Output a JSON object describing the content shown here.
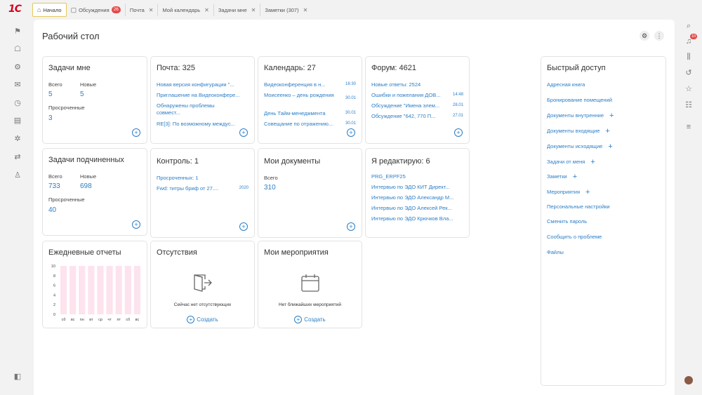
{
  "app": {
    "logo": "1C"
  },
  "tabs": [
    {
      "label": "Начало",
      "icon": "home-icon",
      "active": true
    },
    {
      "label": "Обсуждения",
      "icon": "chat-icon",
      "badge": "26"
    },
    {
      "label": "Почта"
    },
    {
      "label": "Мой календарь"
    },
    {
      "label": "Задачи мне"
    },
    {
      "label": "Заметки (307)"
    }
  ],
  "left_nav": [
    "flag-icon",
    "users-icon",
    "gear-icon",
    "mail-icon",
    "clock-icon",
    "building-icon",
    "settings-icon",
    "sync-icon",
    "person-icon",
    "panel-toggle-icon"
  ],
  "right_nav": {
    "notification_badge": "10",
    "icons": [
      "search-icon",
      "bell-icon",
      "equalizer-icon",
      "history-icon",
      "star-icon",
      "group-icon",
      "filter-icon",
      "avatar"
    ]
  },
  "page": {
    "title": "Рабочий стол",
    "settings_icon": "gear-icon",
    "more_icon": "more-icon"
  },
  "cards": {
    "my_tasks": {
      "title": "Задачи мне",
      "total_label": "Всего",
      "total": "5",
      "new_label": "Новые",
      "new": "5",
      "overdue_label": "Просроченные",
      "overdue": "3"
    },
    "subordinate_tasks": {
      "title": "Задачи подчиненных",
      "total_label": "Всего",
      "total": "733",
      "new_label": "Новые",
      "new": "698",
      "overdue_label": "Просроченные",
      "overdue": "40"
    },
    "mail": {
      "title": "Почта: 325",
      "items": [
        "Новая версия конфигурации \"...",
        "Приглашение на Видеоконфере...",
        "Обнаружены проблемы совмест...",
        "RE[3]: По возможному междус..."
      ]
    },
    "calendar": {
      "title": "Календарь: 27",
      "items": [
        {
          "text": "Видеоконференция в н...",
          "time": "16:30"
        },
        {
          "text": "Моисеенко – день рождения",
          "time": "30.01"
        },
        {
          "text": "День Тайм-менеджмента",
          "time": "30.01"
        },
        {
          "text": "Совещание по отражению...",
          "time": "30.01"
        }
      ]
    },
    "forum": {
      "title": "Форум: 4621",
      "items": [
        {
          "text": "Новые ответы: 2524",
          "time": ""
        },
        {
          "text": "Ошибки и пожелания ДОВ...",
          "time": "14:48"
        },
        {
          "text": "Обсуждение \"Имена элем...",
          "time": "28.01"
        },
        {
          "text": "Обсуждение \"642, 770 П...",
          "time": "27.01"
        }
      ]
    },
    "control": {
      "title": "Контроль: 1",
      "items": [
        {
          "text": "Просроченных: 1",
          "time": ""
        },
        {
          "text": "Fwd: титры бриф от 27....",
          "time": "2020"
        }
      ]
    },
    "my_documents": {
      "title": "Мои документы",
      "total_label": "Всего",
      "total": "310"
    },
    "editing": {
      "title": "Я редактирую: 6",
      "items": [
        "PRG_ERPF25",
        "Интервью по ЭДО  КИТ Директ...",
        "Интервью по ЭДО Александр М...",
        "Интервью по ЭДО Алексей Рек...",
        "Интервью по ЭДО Крючков Вла..."
      ]
    },
    "daily_reports": {
      "title": "Ежедневные отчеты"
    },
    "absences": {
      "title": "Отсутствия",
      "empty": "Сейчас нет отсутствующих",
      "create": "Создать",
      "icon": "exit-door-icon"
    },
    "events": {
      "title": "Мои мероприятия",
      "empty": "Нет ближайших мероприятий",
      "create": "Создать",
      "icon": "calendar-icon"
    }
  },
  "quick_access": {
    "title": "Быстрый доступ",
    "items": [
      {
        "label": "Адресная книга",
        "plus": false
      },
      {
        "label": "Бронирование помещений",
        "plus": false
      },
      {
        "label": "Документы внутренние",
        "plus": true
      },
      {
        "label": "Документы входящие",
        "plus": true
      },
      {
        "label": "Документы исходящие",
        "plus": true
      },
      {
        "label": "Задачи от меня",
        "plus": true
      },
      {
        "label": "Заметки",
        "plus": true
      },
      {
        "label": "Мероприятия",
        "plus": true
      },
      {
        "label": "Персональные настройки",
        "plus": false
      },
      {
        "label": "Сменить пароль",
        "plus": false
      },
      {
        "label": "Сообщить о проблеме",
        "plus": false
      },
      {
        "label": "Файлы",
        "plus": false
      }
    ]
  },
  "chart_data": {
    "type": "bar",
    "categories": [
      "сб",
      "вс",
      "пн",
      "вт",
      "ср",
      "чт",
      "пт",
      "сб",
      "вс"
    ],
    "values": [
      10,
      10,
      10,
      10,
      10,
      10,
      10,
      10,
      10
    ],
    "ylim": [
      0,
      10
    ],
    "yticks": [
      "10",
      "8",
      "6",
      "4",
      "2",
      "0"
    ],
    "color": "#fde3ee"
  }
}
